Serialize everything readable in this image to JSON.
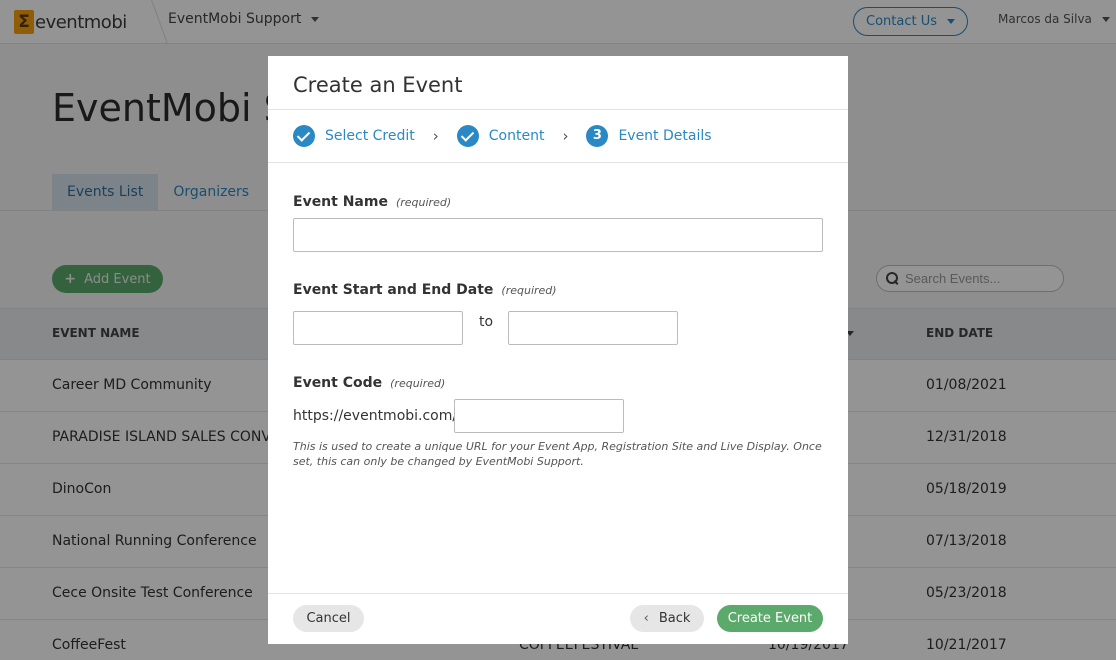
{
  "topbar": {
    "logo_mark": "Σ",
    "logo_text": "eventmobi",
    "org_name": "EventMobi Support",
    "contact_label": "Contact Us",
    "user_name": "Marcos da Silva"
  },
  "page": {
    "title": "EventMobi S",
    "tabs": [
      {
        "label": "Events List",
        "active": true
      },
      {
        "label": "Organizers",
        "active": false
      }
    ],
    "add_event_label": "Add Event",
    "search_placeholder": "Search Events..."
  },
  "table": {
    "headers": {
      "event_name": "EVENT NAME",
      "end_date": "END DATE"
    },
    "rows": [
      {
        "name": "Career MD Community",
        "end_date": "01/08/2021",
        "code": "",
        "start_date": ""
      },
      {
        "name": "PARADISE ISLAND SALES CONVEN",
        "end_date": "12/31/2018",
        "code": "",
        "start_date": ""
      },
      {
        "name": "DinoCon",
        "end_date": "05/18/2019",
        "code": "",
        "start_date": ""
      },
      {
        "name": "National Running Conference",
        "end_date": "07/13/2018",
        "code": "",
        "start_date": ""
      },
      {
        "name": "Cece Onsite Test Conference",
        "end_date": "05/23/2018",
        "code": "",
        "start_date": ""
      },
      {
        "name": "CoffeeFest",
        "end_date": "10/21/2017",
        "code": "COFFEEFESTIVAL",
        "start_date": "10/19/2017"
      }
    ]
  },
  "modal": {
    "title": "Create an Event",
    "steps": [
      {
        "label": "Select Credit",
        "state": "done"
      },
      {
        "label": "Content",
        "state": "done"
      },
      {
        "label": "Event Details",
        "state": "current",
        "number": "3"
      }
    ],
    "event_name": {
      "label": "Event Name",
      "required": "(required)",
      "value": ""
    },
    "dates": {
      "label": "Event Start and End Date",
      "required": "(required)",
      "start_value": "",
      "end_value": "",
      "separator": "to"
    },
    "event_code": {
      "label": "Event Code",
      "required": "(required)",
      "prefix": "https://eventmobi.com/",
      "value": "",
      "help": "This is used to create a unique URL for your Event App, Registration Site and Live Display. Once set, this can only be changed by EventMobi Support."
    },
    "buttons": {
      "cancel": "Cancel",
      "back": "Back",
      "create": "Create Event"
    }
  },
  "colors": {
    "accent": "#2a89c4",
    "success": "#5caa6b",
    "overlay": "rgba(0,0,0,0.42)"
  }
}
